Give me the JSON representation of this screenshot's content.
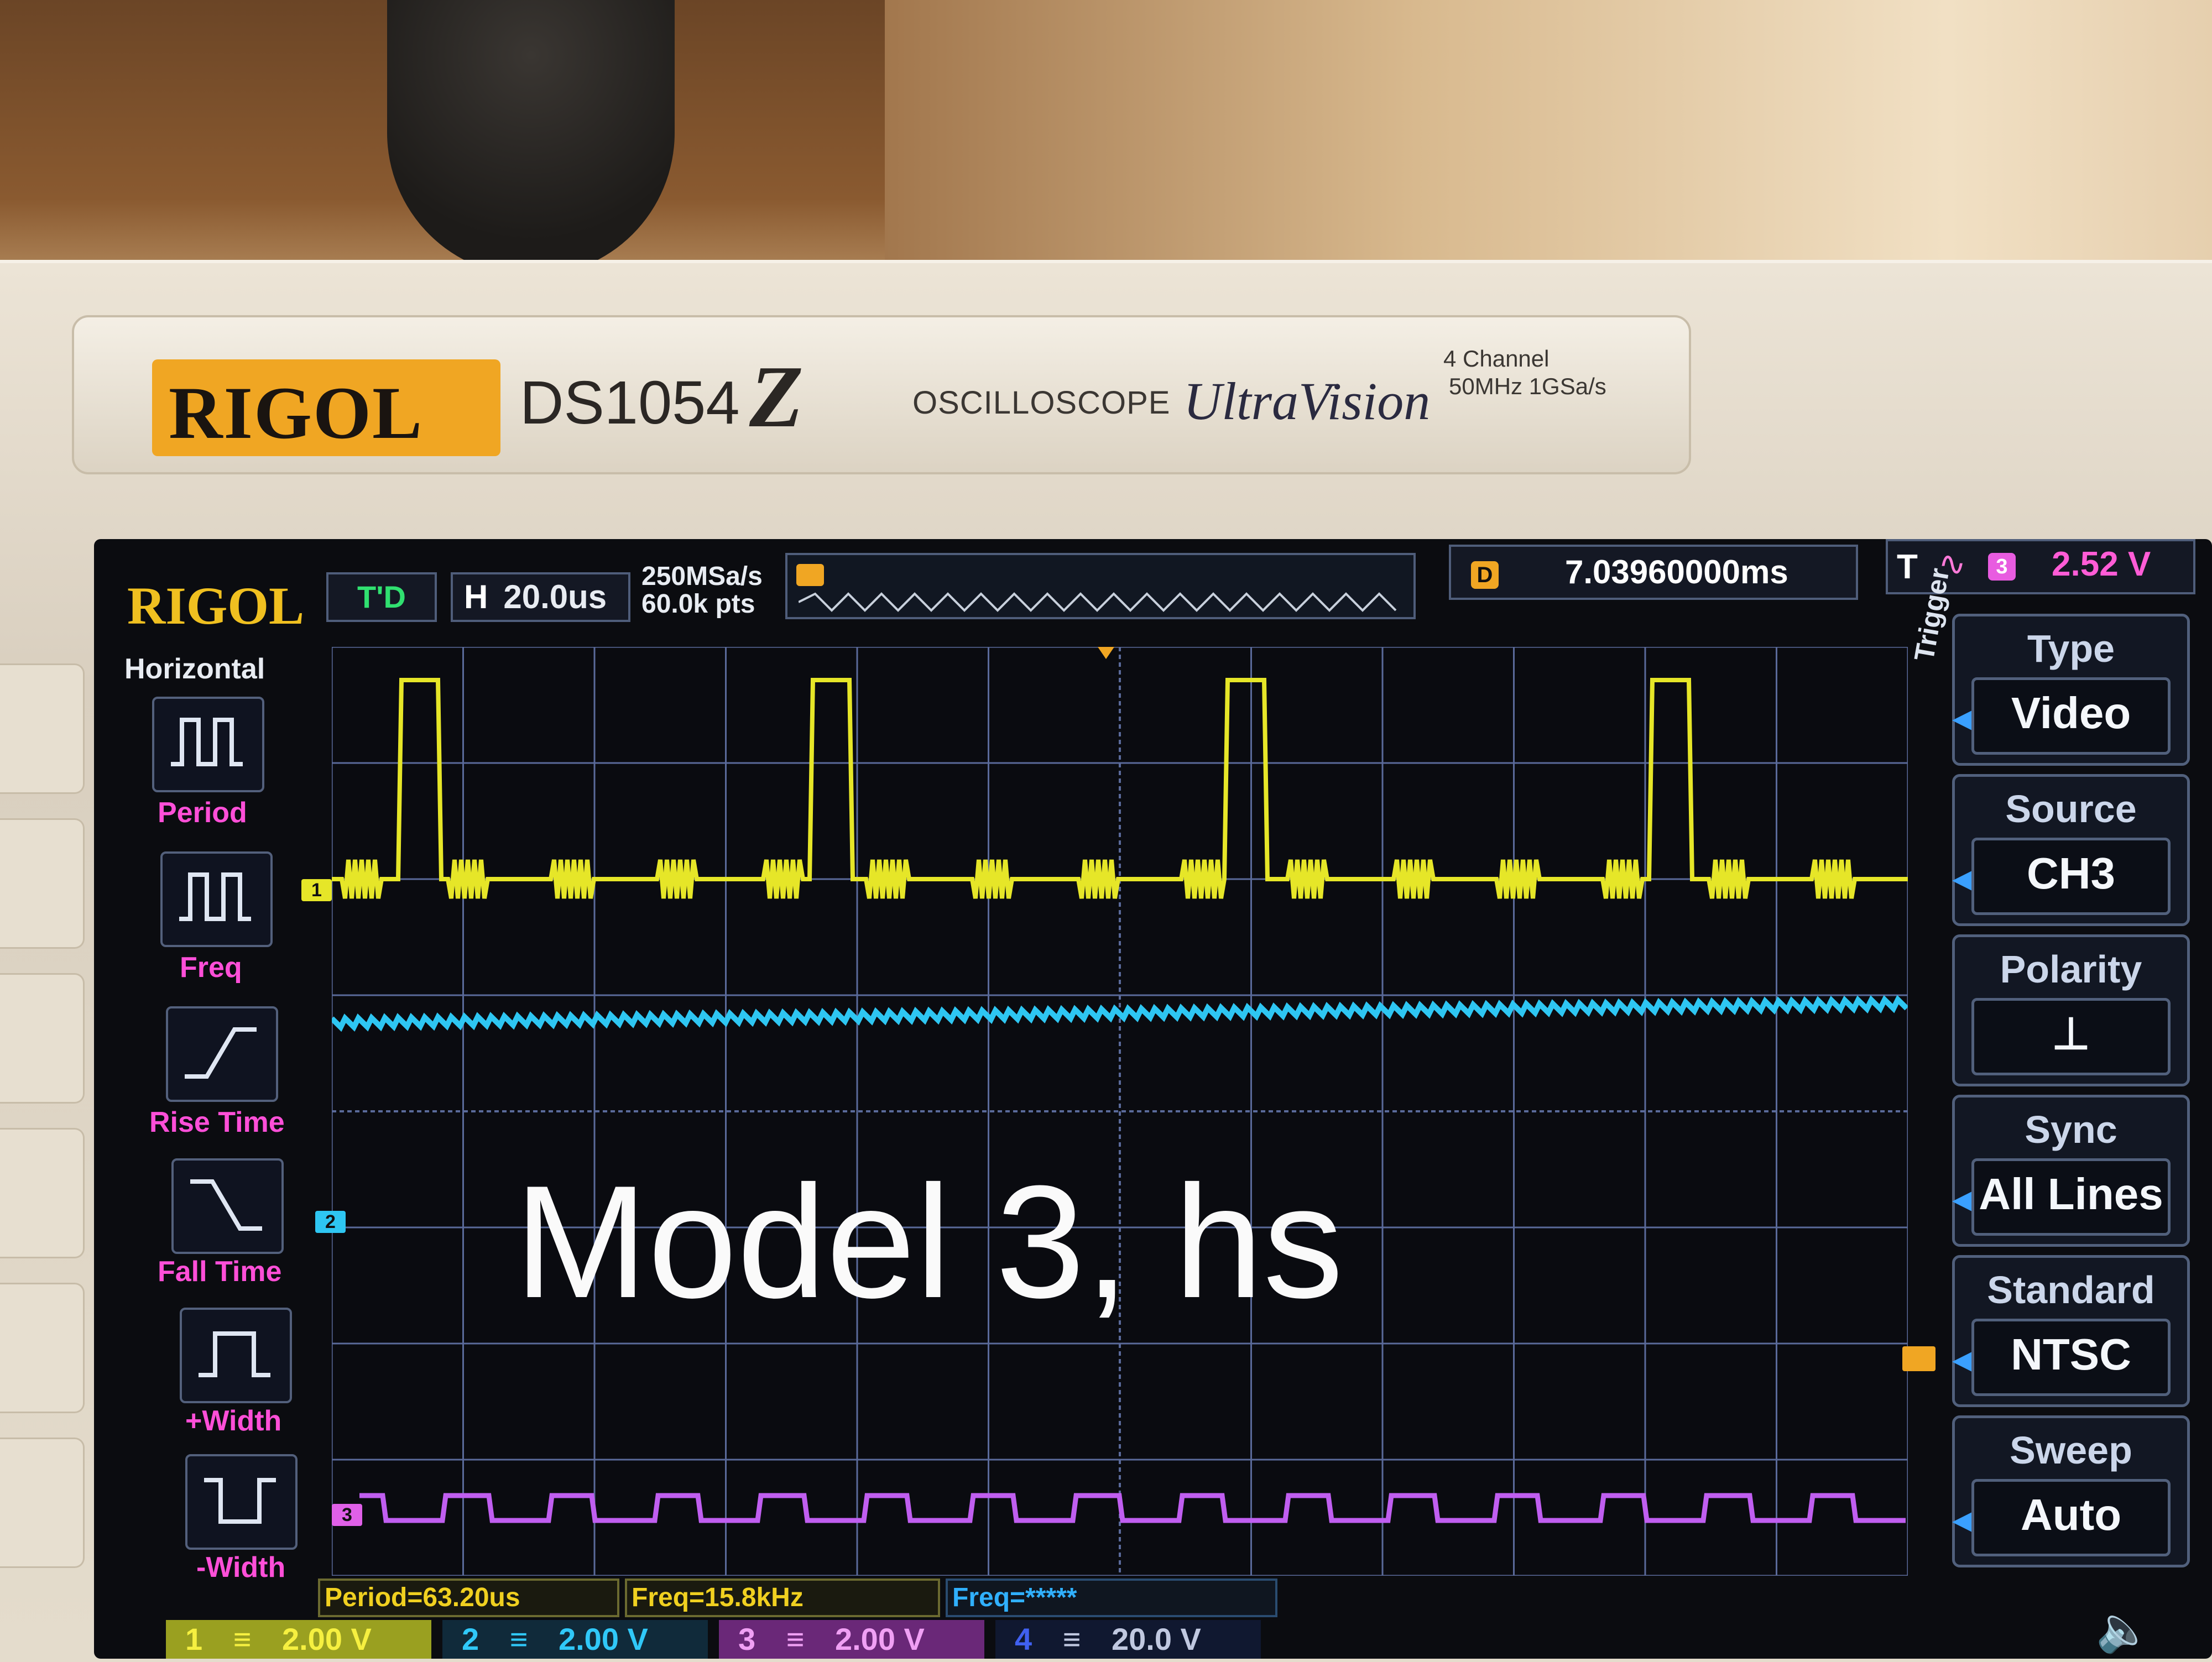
{
  "device": {
    "brand": "RIGOL",
    "model": "DS1054",
    "model_suffix": "Z",
    "type_label": "OSCILLOSCOPE",
    "series": "UltraVision",
    "spec_line1": "4 Channel",
    "spec_line2": "50MHz  1GSa/s"
  },
  "screen": {
    "logo": "RIGOL",
    "status": "T'D",
    "timebase_key": "H",
    "timebase_value": "20.0us",
    "sample_rate": "250MSa/s",
    "memory_depth": "60.0k pts",
    "delay_icon": "D",
    "delay_value": "7.03960000ms",
    "trigger_prefix": "T",
    "trigger_source_num": "3",
    "trigger_level": "2.52 V"
  },
  "left_menu": {
    "title": "Horizontal",
    "items": [
      {
        "label": "Period",
        "icon": "period-icon"
      },
      {
        "label": "Freq",
        "icon": "freq-icon"
      },
      {
        "label": "Rise Time",
        "icon": "rise-time-icon"
      },
      {
        "label": "Fall Time",
        "icon": "fall-time-icon"
      },
      {
        "label": "+Width",
        "icon": "positive-width-icon"
      },
      {
        "label": "-Width",
        "icon": "negative-width-icon"
      }
    ]
  },
  "right_menu": {
    "side_label": "Trigger",
    "items": [
      {
        "title": "Type",
        "value": "Video"
      },
      {
        "title": "Source",
        "value": "CH3"
      },
      {
        "title": "Polarity",
        "value": "⊥"
      },
      {
        "title": "Sync",
        "value": "All Lines"
      },
      {
        "title": "Standard",
        "value": "NTSC"
      },
      {
        "title": "Sweep",
        "value": "Auto"
      }
    ]
  },
  "overlay_text": "Model 3, hs",
  "measurements": {
    "period": "Period=63.20us",
    "freq": "Freq=15.8kHz",
    "freq3": "Freq=*****"
  },
  "channels": [
    {
      "num": "1",
      "scale": "2.00 V",
      "color": "#e8e020"
    },
    {
      "num": "2",
      "scale": "2.00 V",
      "color": "#20c0f0"
    },
    {
      "num": "3",
      "scale": "2.00 V",
      "color": "#e060e8"
    },
    {
      "num": "4",
      "scale": "20.0 V",
      "color": "#3050e0"
    }
  ],
  "markers": {
    "ch1": "1",
    "ch2": "2",
    "ch3": "3"
  },
  "colors": {
    "ch1_trace": "#e6e628",
    "ch2_trace": "#2ec6f2",
    "ch3_trace": "#c05ef0",
    "grid": "#5a6a9a",
    "accent": "#f0a623"
  }
}
